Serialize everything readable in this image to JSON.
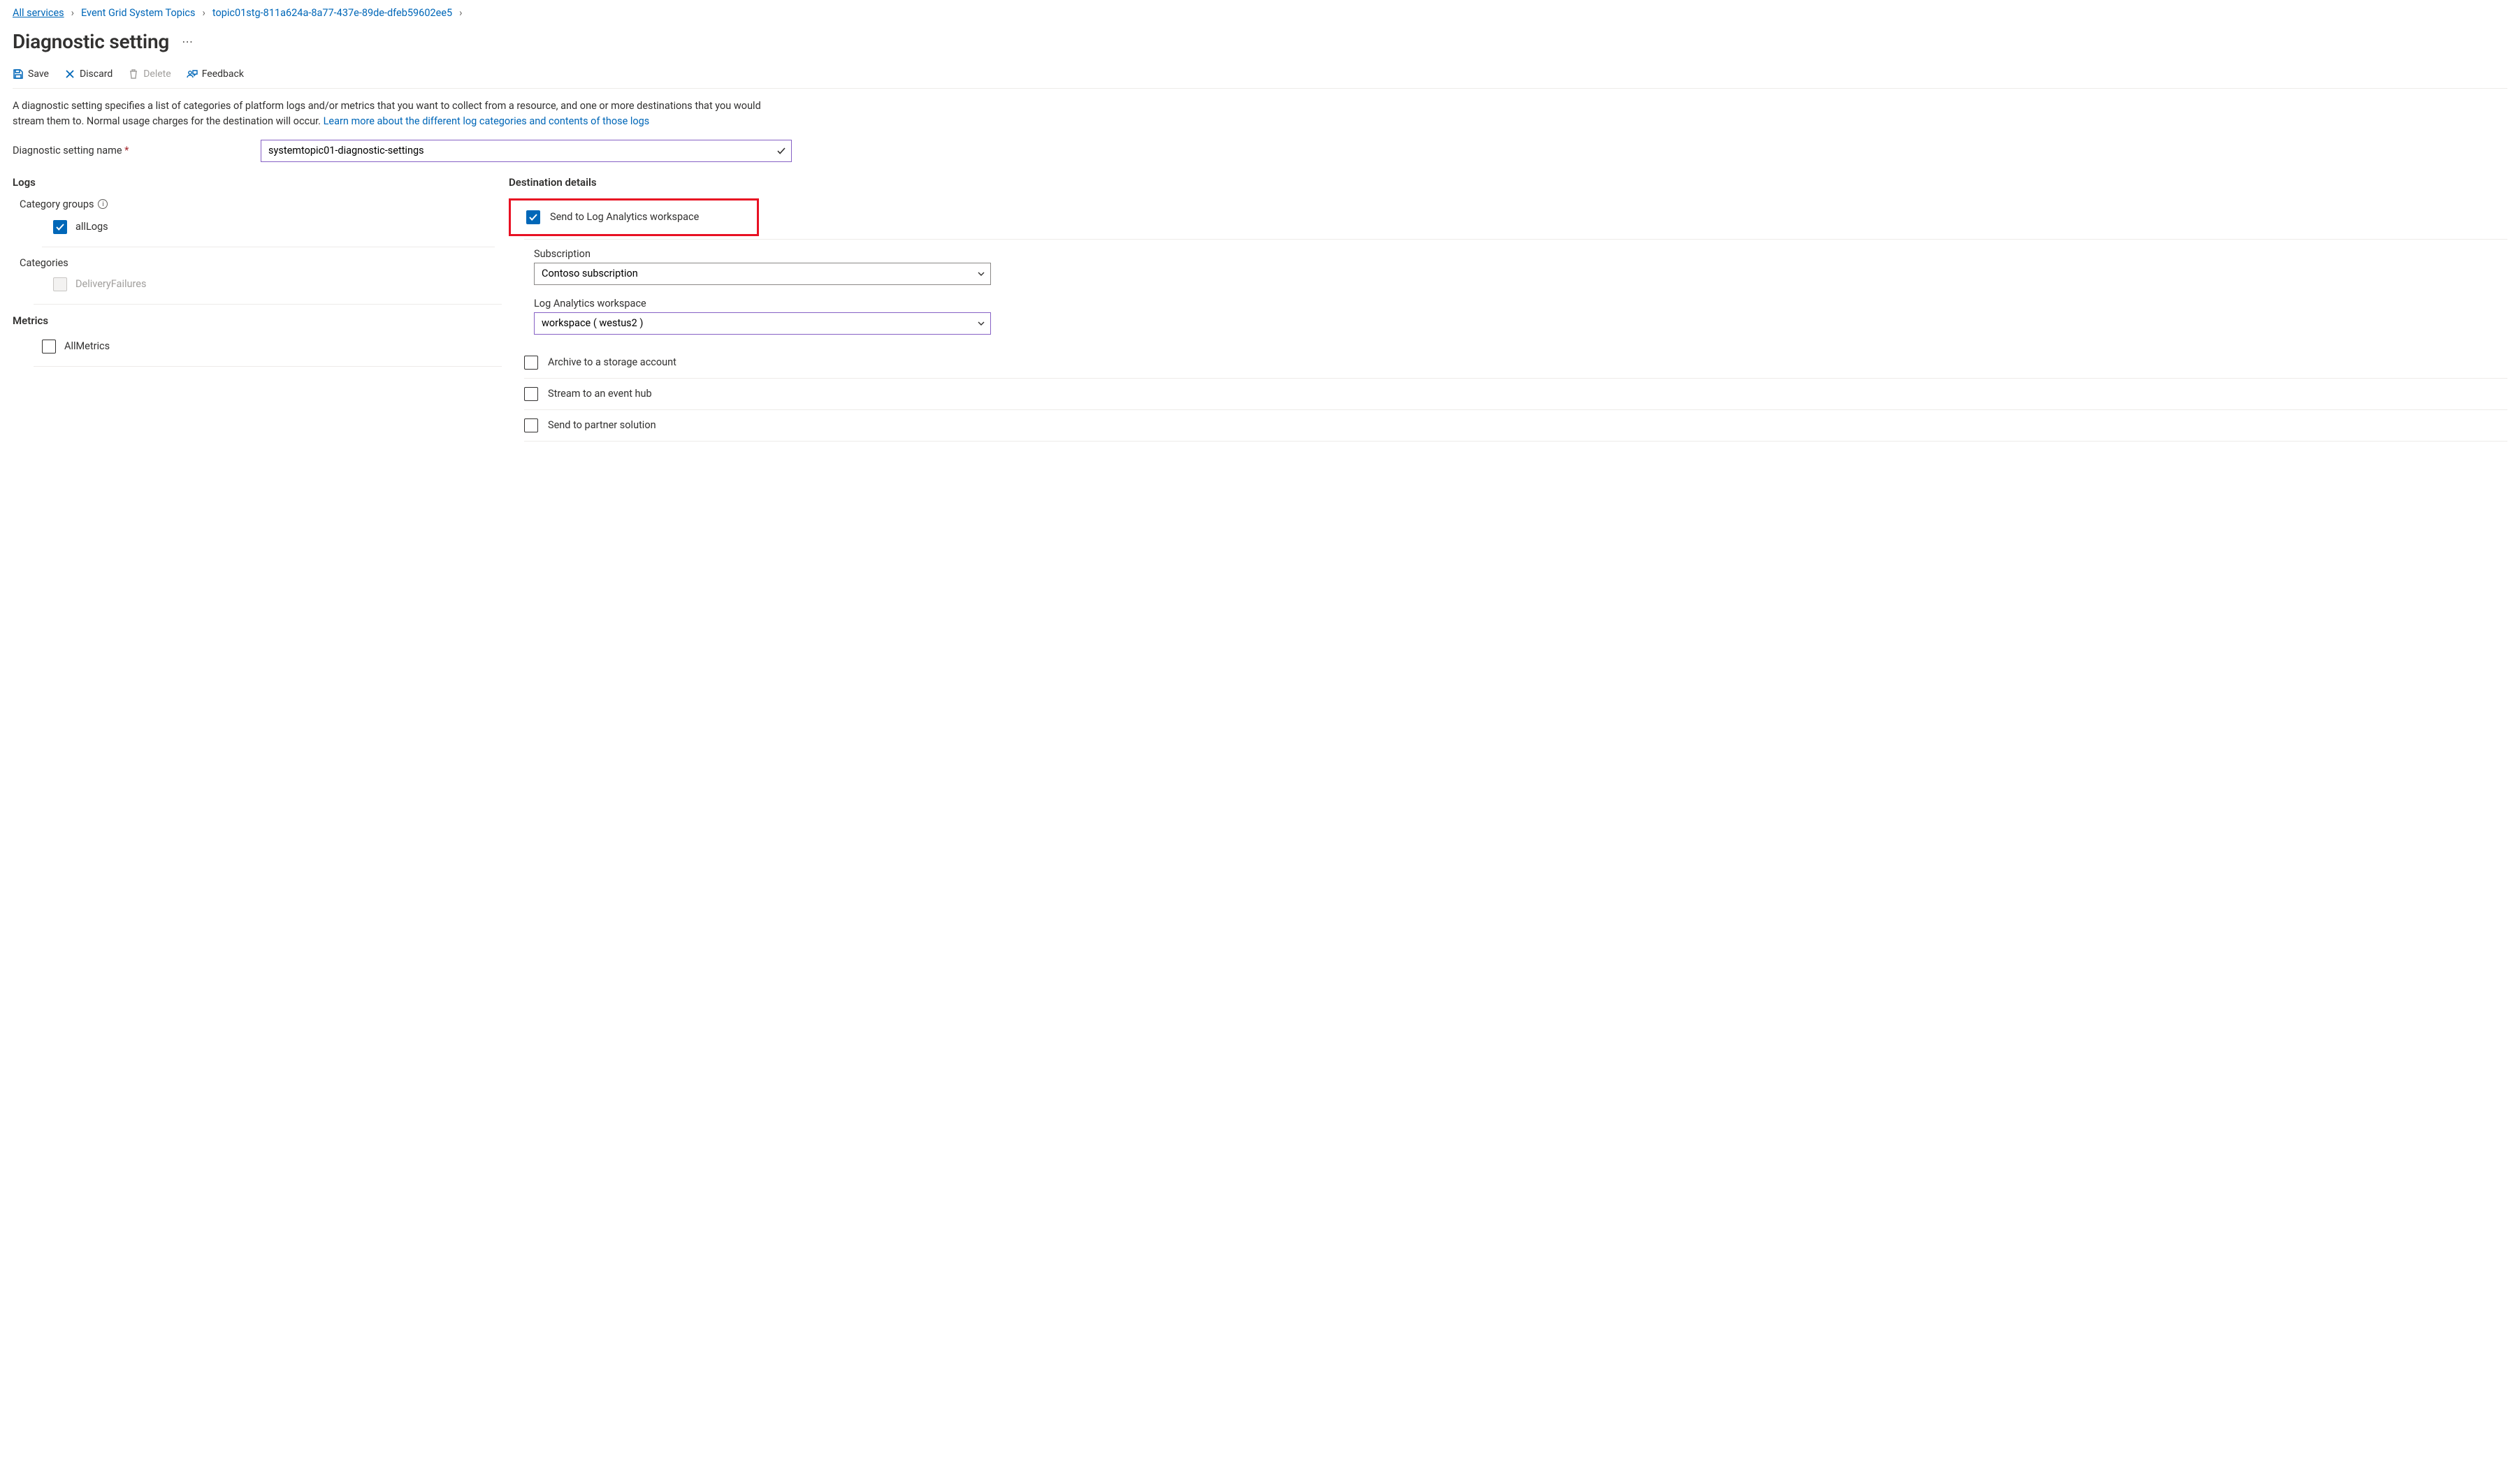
{
  "breadcrumb": {
    "items": [
      {
        "label": "All services"
      },
      {
        "label": "Event Grid System Topics"
      },
      {
        "label": "topic01stg-811a624a-8a77-437e-89de-dfeb59602ee5"
      }
    ]
  },
  "page": {
    "title": "Diagnostic setting"
  },
  "cmdbar": {
    "save": "Save",
    "discard": "Discard",
    "delete": "Delete",
    "feedback": "Feedback"
  },
  "intro": {
    "text": "A diagnostic setting specifies a list of categories of platform logs and/or metrics that you want to collect from a resource, and one or more destinations that you would stream them to. Normal usage charges for the destination will occur. ",
    "link": "Learn more about the different log categories and contents of those logs"
  },
  "name_field": {
    "label": "Diagnostic setting name",
    "value": "systemtopic01-diagnostic-settings"
  },
  "left": {
    "logs_heading": "Logs",
    "category_groups_label": "Category groups",
    "all_logs_label": "allLogs",
    "categories_label": "Categories",
    "delivery_failures_label": "DeliveryFailures",
    "metrics_heading": "Metrics",
    "all_metrics_label": "AllMetrics"
  },
  "right": {
    "heading": "Destination details",
    "dests": [
      {
        "label": "Send to Log Analytics workspace",
        "checked": true,
        "highlight": true
      },
      {
        "label": "Archive to a storage account",
        "checked": false
      },
      {
        "label": "Stream to an event hub",
        "checked": false
      },
      {
        "label": "Send to partner solution",
        "checked": false
      }
    ],
    "subscription_label": "Subscription",
    "subscription_value": "Contoso subscription",
    "workspace_label": "Log Analytics workspace",
    "workspace_value": "workspace ( westus2 )"
  }
}
